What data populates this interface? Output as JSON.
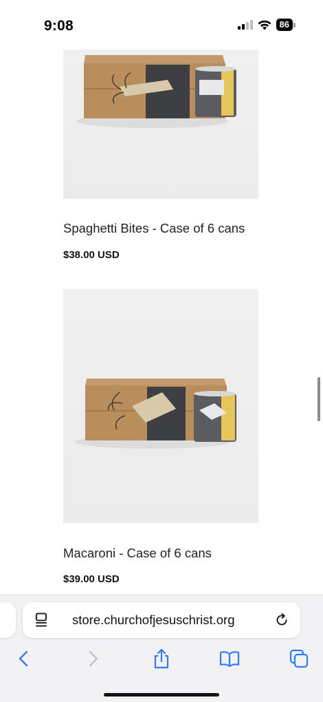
{
  "status_bar": {
    "time": "9:08",
    "battery_level": "86",
    "icons": [
      "cellular-signal-icon",
      "wifi-icon",
      "battery-icon"
    ]
  },
  "products": [
    {
      "name": "Spaghetti Bites - Case of 6 cans",
      "price": "$38.00 USD",
      "image": "spaghetti-bites-case-image"
    },
    {
      "name": "Macaroni - Case of 6 cans",
      "price": "$39.00 USD",
      "image": "macaroni-case-image"
    }
  ],
  "browser": {
    "url": "store.churchofjesuschrist.org",
    "toolbar": [
      "back-icon",
      "forward-icon",
      "share-icon",
      "bookmarks-icon",
      "tabs-icon"
    ],
    "accent_color": "#2f7bf6",
    "disabled_color": "#b9c3cf"
  }
}
